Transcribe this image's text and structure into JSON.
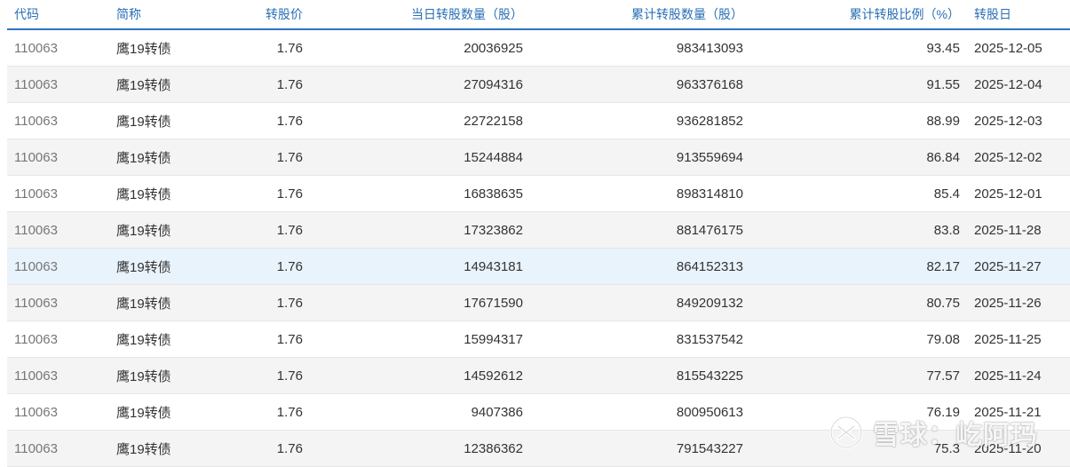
{
  "table": {
    "headers": [
      "代码",
      "简称",
      "转股价",
      "当日转股数量（股）",
      "累计转股数量（股）",
      "累计转股比例（%）",
      "转股日"
    ],
    "rows": [
      [
        "110063",
        "鹰19转债",
        "1.76",
        "20036925",
        "983413093",
        "93.45",
        "2025-12-05"
      ],
      [
        "110063",
        "鹰19转债",
        "1.76",
        "27094316",
        "963376168",
        "91.55",
        "2025-12-04"
      ],
      [
        "110063",
        "鹰19转债",
        "1.76",
        "22722158",
        "936281852",
        "88.99",
        "2025-12-03"
      ],
      [
        "110063",
        "鹰19转债",
        "1.76",
        "15244884",
        "913559694",
        "86.84",
        "2025-12-02"
      ],
      [
        "110063",
        "鹰19转债",
        "1.76",
        "16838635",
        "898314810",
        "85.4",
        "2025-12-01"
      ],
      [
        "110063",
        "鹰19转债",
        "1.76",
        "17323862",
        "881476175",
        "83.8",
        "2025-11-28"
      ],
      [
        "110063",
        "鹰19转债",
        "1.76",
        "14943181",
        "864152313",
        "82.17",
        "2025-11-27"
      ],
      [
        "110063",
        "鹰19转债",
        "1.76",
        "17671590",
        "849209132",
        "80.75",
        "2025-11-26"
      ],
      [
        "110063",
        "鹰19转债",
        "1.76",
        "15994317",
        "831537542",
        "79.08",
        "2025-11-25"
      ],
      [
        "110063",
        "鹰19转债",
        "1.76",
        "14592612",
        "815543225",
        "77.57",
        "2025-11-24"
      ],
      [
        "110063",
        "鹰19转债",
        "1.76",
        "9407386",
        "800950613",
        "76.19",
        "2025-11-21"
      ],
      [
        "110063",
        "鹰19转债",
        "1.76",
        "12386362",
        "791543227",
        "75.3",
        "2025-11-20"
      ]
    ],
    "highlighted_row": 6
  },
  "watermark": {
    "text": "雪球：屹阿玛",
    "icon": "snowball-logo-icon"
  },
  "colors": {
    "header_text": "#2a6fb5",
    "header_rule": "#2f74c0",
    "stripe": "#f4f4f4",
    "highlight": "#e9f3fc"
  }
}
